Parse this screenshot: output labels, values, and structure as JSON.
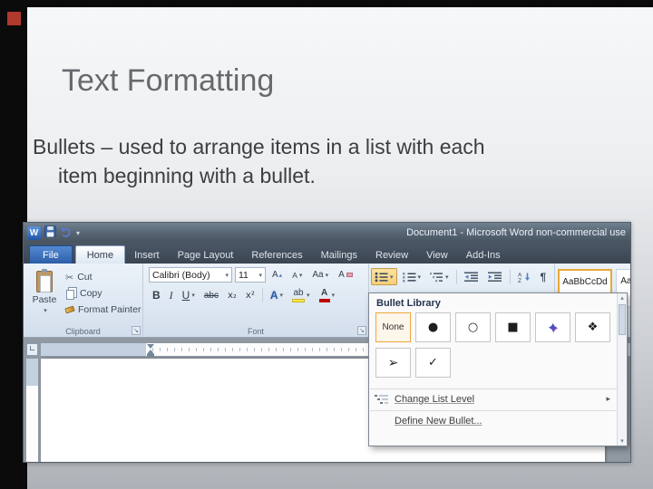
{
  "slide": {
    "title": "Text Formatting",
    "body_lines": [
      "Bullets – used to arrange items in a list with each",
      "item beginning with a bullet."
    ]
  },
  "word": {
    "title_bar": "Document1 - Microsoft Word non-commercial use",
    "tabs": [
      {
        "label": "File"
      },
      {
        "label": "Home"
      },
      {
        "label": "Insert"
      },
      {
        "label": "Page Layout"
      },
      {
        "label": "References"
      },
      {
        "label": "Mailings"
      },
      {
        "label": "Review"
      },
      {
        "label": "View"
      },
      {
        "label": "Add-Ins"
      }
    ],
    "ribbon": {
      "clipboard": {
        "group_label": "Clipboard",
        "paste": "Paste",
        "cut": "Cut",
        "copy": "Copy",
        "format_painter": "Format Painter"
      },
      "font": {
        "group_label": "Font",
        "family": "Calibri (Body)",
        "size": "11",
        "bold": "B",
        "italic": "I",
        "underline": "U",
        "strikethrough": "abc",
        "subscript": "x₂",
        "superscript": "x²",
        "grow": "A",
        "shrink": "A",
        "change_case": "Aa",
        "clear": "A",
        "effects": "A",
        "highlight": "ab",
        "font_color": "A"
      },
      "paragraph": {
        "pilcrow": "¶"
      },
      "styles": {
        "style1": "AaBbCcDd",
        "style2": "AaBbCcDd"
      }
    },
    "bullet_menu": {
      "title": "Bullet Library",
      "none": "None",
      "bullets": [
        {
          "name": "filled-circle",
          "glyph": "●"
        },
        {
          "name": "hollow-circle",
          "glyph": "○"
        },
        {
          "name": "filled-square",
          "glyph": "■"
        },
        {
          "name": "star",
          "glyph": "✦",
          "color": "#4a52c0"
        },
        {
          "name": "four-diamonds",
          "glyph": "❖"
        },
        {
          "name": "arrowhead",
          "glyph": "➢"
        },
        {
          "name": "checkmark",
          "glyph": "✓"
        }
      ],
      "change_list_level": "Change List Level",
      "define_new_bullet": "Define New Bullet..."
    },
    "icons": {
      "logo": "W",
      "dropdown": "▾",
      "up": "▴",
      "submenu": "▸",
      "scissors": "✂",
      "tab_selector": "∟",
      "launcher": "↘"
    },
    "colors": {
      "selection_orange": "#f0a63c",
      "file_tab_blue": "#2e63ab",
      "highlight_yellow": "#ffe94a",
      "font_color_red": "#c00000",
      "star_bullet_blue": "#4a52c0"
    }
  }
}
